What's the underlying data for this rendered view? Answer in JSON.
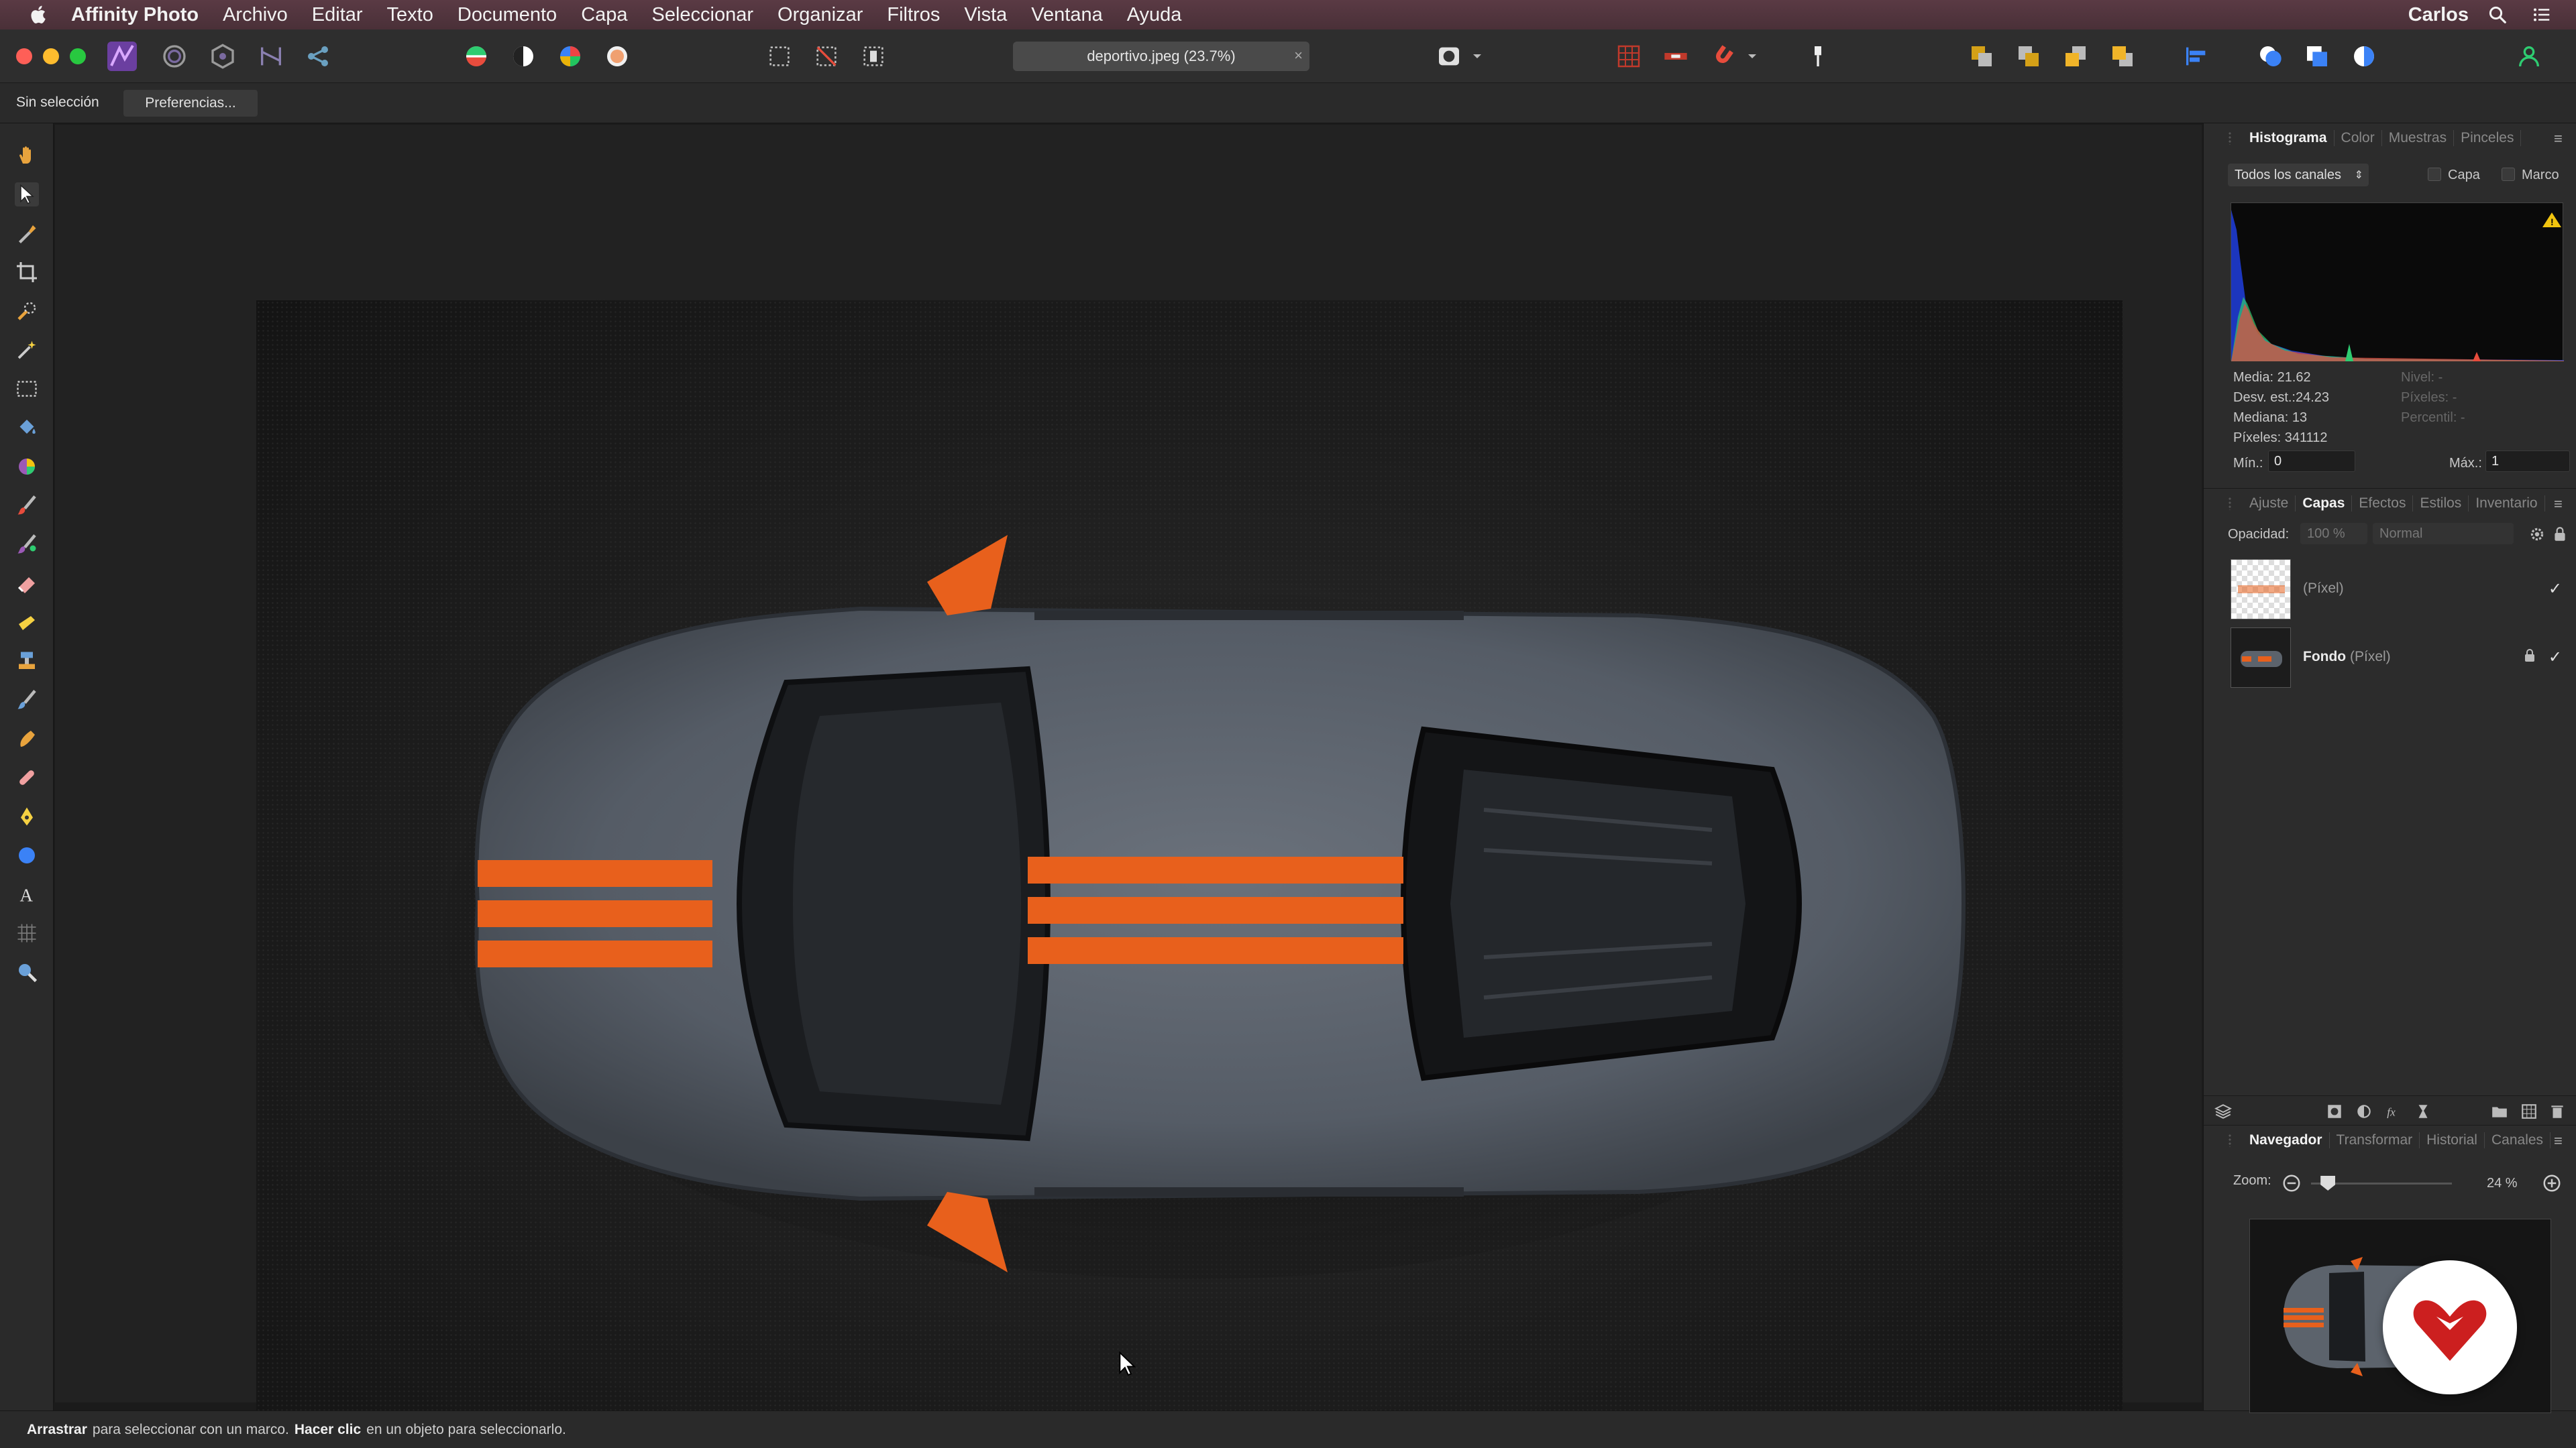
{
  "menubar": {
    "app_name": "Affinity Photo",
    "items": [
      "Archivo",
      "Editar",
      "Texto",
      "Documento",
      "Capa",
      "Seleccionar",
      "Organizar",
      "Filtros",
      "Vista",
      "Ventana",
      "Ayuda"
    ],
    "user": "Carlos"
  },
  "toolbar": {
    "document_tab": "deportivo.jpeg (23.7%)",
    "close_glyph": "×"
  },
  "contextbar": {
    "selection_status": "Sin selección",
    "preferences_label": "Preferencias..."
  },
  "tools": [
    "hand-tool-icon",
    "move-tool-icon",
    "color-picker-icon",
    "crop-tool-icon",
    "selection-brush-icon",
    "magic-wand-icon",
    "marquee-tool-icon",
    "flood-fill-icon",
    "gradient-tool-icon",
    "paint-brush-icon",
    "color-replace-brush-icon",
    "erase-brush-icon",
    "dodge-brush-icon",
    "clone-brush-icon",
    "inpainting-brush-icon",
    "smudge-brush-icon",
    "healing-brush-icon",
    "pen-tool-icon",
    "shape-tool-icon",
    "text-tool-icon",
    "mesh-warp-icon",
    "zoom-tool-icon"
  ],
  "histogram_panel": {
    "tabs": [
      "Histograma",
      "Color",
      "Muestras",
      "Pinceles"
    ],
    "active_tab": "Histograma",
    "channel_select": "Todos los canales",
    "layer_checkbox": "Capa",
    "frame_checkbox": "Marco",
    "stats": {
      "mean": "Media: 21.62",
      "std_dev": "Desv. est.:24.23",
      "median": "Mediana: 13",
      "pixels": "Píxeles: 341112",
      "level": "Nivel: -",
      "pixels_right": "Píxeles: -",
      "percentile": "Percentil: -"
    },
    "min_label": "Mín.:",
    "min_value": "0",
    "max_label": "Máx.:",
    "max_value": "1"
  },
  "layers_panel": {
    "tabs": [
      "Ajuste",
      "Capas",
      "Efectos",
      "Estilos",
      "Inventario"
    ],
    "active_tab": "Capas",
    "opacity_label": "Opacidad:",
    "opacity_value": "100 %",
    "blend_mode": "Normal",
    "layers": [
      {
        "name": "",
        "type": "(Píxel)",
        "visible_glyph": "✓"
      },
      {
        "name": "Fondo",
        "type": "(Píxel)",
        "visible_glyph": "✓",
        "locked": true
      }
    ]
  },
  "navigator_panel": {
    "tabs": [
      "Navegador",
      "Transformar",
      "Historial",
      "Canales"
    ],
    "active_tab": "Navegador",
    "zoom_label": "Zoom:",
    "zoom_value": "24 %",
    "zoom_slider_fraction": 0.12
  },
  "statusbar": {
    "b1": "Arrastrar",
    "t1": "para seleccionar con un marco.",
    "b2": "Hacer clic",
    "t2": "en un objeto para seleccionarlo."
  },
  "colors": {
    "accent_orange": "#e8601c",
    "car_grey": "#5f6670",
    "traffic_red": "#fe5f57",
    "traffic_yellow": "#febc2e",
    "traffic_green": "#28c840"
  }
}
